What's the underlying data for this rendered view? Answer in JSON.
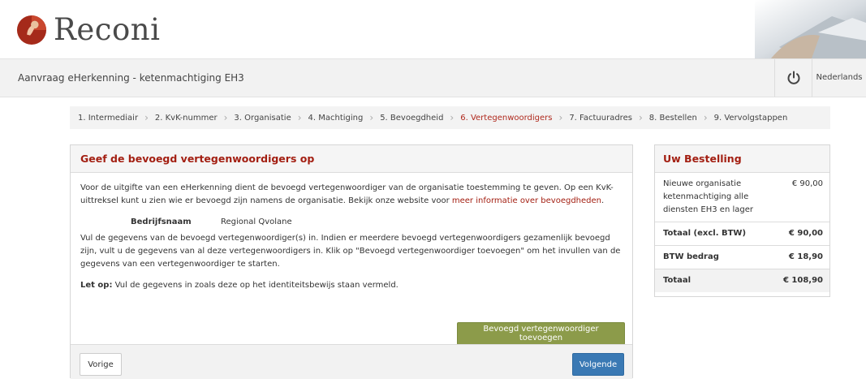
{
  "brand": {
    "name": "Reconi",
    "color": "#a31f12"
  },
  "titlebar": {
    "title": "Aanvraag eHerkenning - ketenmachtiging EH3",
    "power_icon": "power-icon",
    "language": "Nederlands"
  },
  "steps": [
    {
      "label": "1. Intermediair",
      "active": false
    },
    {
      "label": "2. KvK-nummer",
      "active": false
    },
    {
      "label": "3. Organisatie",
      "active": false
    },
    {
      "label": "4. Machtiging",
      "active": false
    },
    {
      "label": "5. Bevoegdheid",
      "active": false
    },
    {
      "label": "6. Vertegenwoordigers",
      "active": true
    },
    {
      "label": "7. Factuuradres",
      "active": false
    },
    {
      "label": "8. Bestellen",
      "active": false
    },
    {
      "label": "9. Vervolgstappen",
      "active": false
    }
  ],
  "main": {
    "heading": "Geef de bevoegd vertegenwoordigers op",
    "intro_text": "Voor de uitgifte van een eHerkenning dient de bevoegd vertegenwoordiger van de organisatie toestemming te geven. Op een KvK-uittreksel kunt u zien wie er bevoegd zijn namens de organisatie. Bekijk onze website voor ",
    "intro_link": "meer informatie over bevoegdheden",
    "intro_end": ".",
    "company_label": "Bedrijfsnaam",
    "company_value": "Regional Qvolane",
    "instructions": "Vul de gegevens van de bevoegd vertegenwoordiger(s) in. Indien er meerdere bevoegd vertegenwoordigers gezamenlijk bevoegd zijn, vult u de gegevens van al deze vertegenwoordigers in. Klik op \"Bevoegd vertegenwoordiger toevoegen\" om het invullen van de gegevens van een vertegenwoordiger te starten.",
    "note_label": "Let op:",
    "note_text": " Vul de gegevens in zoals deze op het identiteitsbewijs staan vermeld.",
    "add_button": "Bevoegd vertegenwoordiger toevoegen",
    "prev_button": "Vorige",
    "next_button": "Volgende"
  },
  "order": {
    "heading": "Uw Bestelling",
    "item_label": "Nieuwe organisatie ketenmachtiging alle diensten EH3 en lager",
    "item_price": "€ 90,00",
    "subtotal_label": "Totaal (excl. BTW)",
    "subtotal_value": "€ 90,00",
    "vat_label": "BTW bedrag",
    "vat_value": "€ 18,90",
    "total_label": "Totaal",
    "total_value": "€ 108,90"
  },
  "colors": {
    "accent": "#a31f12",
    "add_button": "#8c9b4a",
    "next_button": "#3a79b4"
  }
}
